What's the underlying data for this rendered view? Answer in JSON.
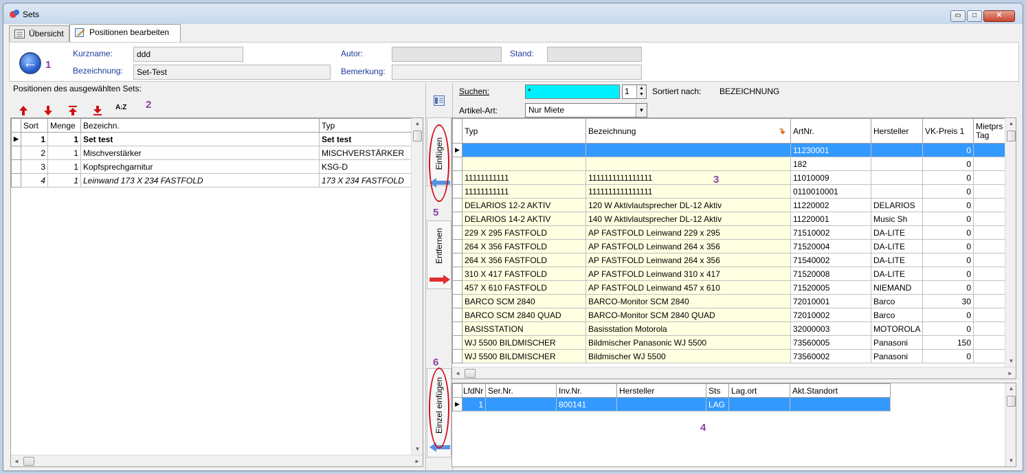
{
  "window": {
    "title": "Sets",
    "minimize_glyph": "▭",
    "maximize_glyph": "□",
    "close_glyph": "✕"
  },
  "tabs": [
    {
      "label": "Übersicht",
      "icon": "list-icon"
    },
    {
      "label": "Positionen bearbeiten",
      "icon": "edit-icon"
    }
  ],
  "header": {
    "back_glyph": "←",
    "kurzname_label": "Kurzname:",
    "kurzname_value": "ddd",
    "bezeichnung_label": "Bezeichnung:",
    "bezeichnung_value": "Set-Test",
    "autor_label": "Autor:",
    "autor_value": "",
    "bemerkung_label": "Bemerkung:",
    "bemerkung_value": "",
    "stand_label": "Stand:",
    "stand_value": ""
  },
  "annotations": [
    "1",
    "2",
    "3",
    "4",
    "5",
    "6"
  ],
  "positions": {
    "title": "Positionen des ausgewählten Sets:",
    "toolbar_icons": [
      "move-up-icon",
      "move-down-icon",
      "move-top-icon",
      "move-bottom-icon",
      "sort-az-icon"
    ],
    "sort_glyph": "A↓Z",
    "columns": [
      "Sort",
      "Menge",
      "Bezeichn.",
      "Typ"
    ],
    "rows": [
      {
        "sort": "1",
        "menge": "1",
        "bezeichn": "Set test",
        "typ": "Set test",
        "style": "bold",
        "current": true
      },
      {
        "sort": "2",
        "menge": "1",
        "bezeichn": "Mischverstärker",
        "typ": "MISCHVERSTÄRKER",
        "style": "",
        "current": false
      },
      {
        "sort": "3",
        "menge": "1",
        "bezeichn": "Kopfsprechgarnitur",
        "typ": "KSG-D",
        "style": "",
        "current": false
      },
      {
        "sort": "4",
        "menge": "1",
        "bezeichn": "Leinwand 173 X 234 FASTFOLD",
        "typ": "173 X 234 FASTFOLD",
        "style": "italic",
        "current": false
      }
    ]
  },
  "middle": {
    "einfuegen_label": "Einfügen",
    "entfernen_label": "Entfernen",
    "einzel_label": "Einzel einfügen"
  },
  "search": {
    "suchen_label": "Suchen:",
    "suchen_value": "*",
    "spin_value": "1",
    "sortiert_label": "Sortiert nach:",
    "sortiert_value": "BEZEICHNUNG",
    "artikelart_label": "Artikel-Art:",
    "artikelart_value": "Nur Miete"
  },
  "articles": {
    "columns": [
      "Typ",
      "Bezeichnung",
      "ArtNr.",
      "Hersteller",
      "VK-Preis 1",
      "Mietprs Tag"
    ],
    "rows": [
      {
        "typ": "",
        "bez": "",
        "artnr": "11230001",
        "hersteller": "",
        "vk": "0",
        "selected": true
      },
      {
        "typ": "",
        "bez": "",
        "artnr": "182",
        "hersteller": "",
        "vk": "0",
        "selected": false
      },
      {
        "typ": "11111111111",
        "bez": "1111111111111111",
        "artnr": "11010009",
        "hersteller": "",
        "vk": "0",
        "selected": false
      },
      {
        "typ": "11111111111",
        "bez": "1111111111111111",
        "artnr": "0110010001",
        "hersteller": "",
        "vk": "0",
        "selected": false
      },
      {
        "typ": "DELARIOS 12-2 AKTIV",
        "bez": "120 W Aktivlautsprecher DL-12 Aktiv",
        "artnr": "11220002",
        "hersteller": "DELARIOS",
        "vk": "0",
        "selected": false
      },
      {
        "typ": "DELARIOS 14-2 AKTIV",
        "bez": "140 W Aktivlautsprecher DL-12 Aktiv",
        "artnr": "11220001",
        "hersteller": "Music Sh",
        "vk": "0",
        "selected": false
      },
      {
        "typ": "229 X 295   FASTFOLD",
        "bez": "AP FASTFOLD Leinwand 229 x 295",
        "artnr": "71510002",
        "hersteller": "DA-LITE",
        "vk": "0",
        "selected": false
      },
      {
        "typ": "264 X 356 FASTFOLD",
        "bez": "AP FASTFOLD Leinwand 264 x 356",
        "artnr": "71520004",
        "hersteller": "DA-LITE",
        "vk": "0",
        "selected": false
      },
      {
        "typ": "264 X 356 FASTFOLD",
        "bez": "AP FASTFOLD Leinwand 264 x 356",
        "artnr": "71540002",
        "hersteller": "DA-LITE",
        "vk": "0",
        "selected": false
      },
      {
        "typ": "310 X 417 FASTFOLD",
        "bez": "AP FASTFOLD Leinwand 310 x 417",
        "artnr": "71520008",
        "hersteller": "DA-LITE",
        "vk": "0",
        "selected": false
      },
      {
        "typ": "457 X 610 FASTFOLD",
        "bez": "AP FASTFOLD Leinwand 457 x 610",
        "artnr": "71520005",
        "hersteller": "NIEMAND",
        "vk": "0",
        "selected": false
      },
      {
        "typ": "BARCO SCM 2840",
        "bez": "BARCO-Monitor SCM 2840",
        "artnr": "72010001",
        "hersteller": "Barco",
        "vk": "30",
        "selected": false
      },
      {
        "typ": "BARCO SCM 2840 QUAD",
        "bez": "BARCO-Monitor SCM 2840 QUAD",
        "artnr": "72010002",
        "hersteller": "Barco",
        "vk": "0",
        "selected": false
      },
      {
        "typ": "BASISSTATION",
        "bez": "Basisstation Motorola",
        "artnr": "32000003",
        "hersteller": "MOTOROLA",
        "vk": "0",
        "selected": false
      },
      {
        "typ": "WJ 5500 BILDMISCHER",
        "bez": "Bildmischer Panasonic WJ 5500",
        "artnr": "73560005",
        "hersteller": "Panasoni",
        "vk": "150",
        "selected": false
      },
      {
        "typ": "WJ 5500 BILDMISCHER",
        "bez": "Bildmischer WJ 5500",
        "artnr": "73560002",
        "hersteller": "Panasoni",
        "vk": "0",
        "selected": false
      }
    ]
  },
  "inventory": {
    "columns": [
      "LfdNr",
      "Ser.Nr.",
      "Inv.Nr.",
      "Hersteller",
      "Sts",
      "Lag.ort",
      "Akt.Standort"
    ],
    "rows": [
      {
        "lfdnr": "1",
        "sernr": "",
        "invnr": "800141",
        "hersteller": "",
        "sts": "LAG",
        "lagort": "",
        "standort": "",
        "selected": true
      }
    ]
  },
  "colors": {
    "annotation": "#8e3fa6",
    "selection": "#3399ff",
    "search_highlight": "#00f0ff",
    "row_background": "#ffffe1",
    "circle_mark": "#d0101a"
  }
}
